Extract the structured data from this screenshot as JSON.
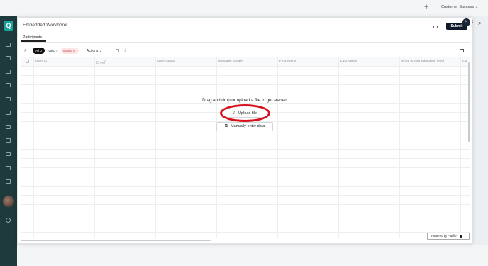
{
  "app": {
    "workspace": "Customer Success",
    "right_partial": "ck",
    "logo_letter": "Q"
  },
  "modal": {
    "title": "Embedded Workbook",
    "tab": "Participants",
    "submit_label": "Submit",
    "close_symbol": "×"
  },
  "filters": {
    "all_label": "All",
    "all_count": "0",
    "valid_label": "Valid",
    "valid_count": "0",
    "invalid_label": "Invalid",
    "invalid_count": "0",
    "actions_label": "Actions"
  },
  "table": {
    "columns": [
      "User ID",
      "Email",
      "User Status",
      "Manager Emails",
      "First Name",
      "Last Name",
      "What is your education level",
      "Cur"
    ]
  },
  "empty_state": {
    "message": "Drag and drop or upload a file to get started",
    "upload_label": "Upload file",
    "manual_label": "Manually enter data"
  },
  "footer": {
    "powered_by": "Powered by Flatfile"
  },
  "colors": {
    "accent": "#0f1a2a",
    "annotation": "#d8101b",
    "invalid": "#d14848",
    "sidebar": "#1f3a3c"
  },
  "icons": [
    "search-icon",
    "trash-icon",
    "download-icon",
    "columns-icon",
    "upload-icon",
    "edit-icon",
    "cast-icon",
    "close-icon",
    "plus-icon",
    "chevron-down-icon"
  ]
}
